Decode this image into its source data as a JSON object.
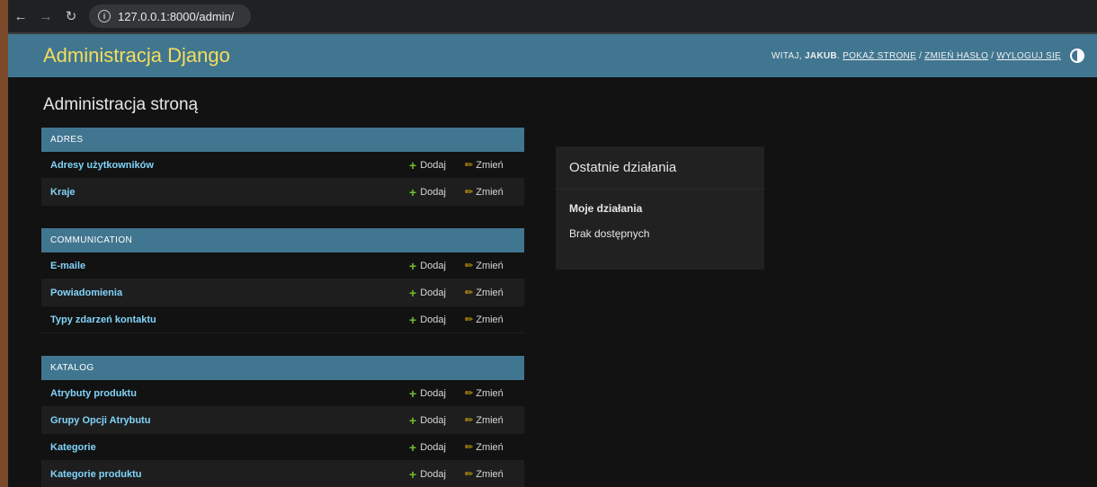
{
  "browser": {
    "url": "127.0.0.1:8000/admin/"
  },
  "header": {
    "branding": "Administracja Django",
    "welcome": "WITAJ,",
    "username": "JAKUB",
    "view_site": "POKAŻ STRONĘ",
    "change_password": "ZMIEŃ HASŁO",
    "logout": "WYLOGUJ SIĘ",
    "separator": "/"
  },
  "page": {
    "title": "Administracja stroną"
  },
  "actions": {
    "add_label": "Dodaj",
    "change_label": "Zmień"
  },
  "modules": [
    {
      "caption": "ADRES",
      "rows": [
        "Adresy użytkowników",
        "Kraje"
      ]
    },
    {
      "caption": "COMMUNICATION",
      "rows": [
        "E-maile",
        "Powiadomienia",
        "Typy zdarzeń kontaktu"
      ]
    },
    {
      "caption": "KATALOG",
      "rows": [
        "Atrybuty produktu",
        "Grupy Opcji Atrybutu",
        "Kategorie",
        "Kategorie produktu"
      ]
    }
  ],
  "recent_actions": {
    "title": "Ostatnie działania",
    "subtitle": "Moje działania",
    "empty": "Brak dostępnych"
  },
  "colors": {
    "header_bg": "#417690",
    "branding": "#f5dd5d",
    "link": "#81d4fa",
    "add_icon": "#70bf2b",
    "change_icon": "#efb80b",
    "body_bg": "#121212"
  },
  "icons": [
    "back-arrow-icon",
    "forward-arrow-icon",
    "reload-icon",
    "info-icon",
    "theme-toggle-icon",
    "plus-icon",
    "pencil-icon"
  ]
}
